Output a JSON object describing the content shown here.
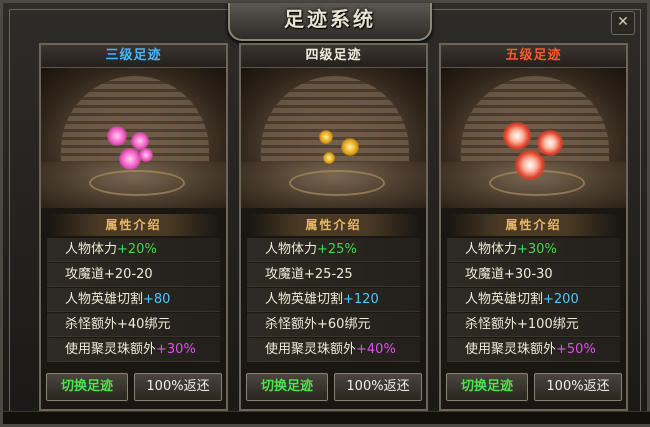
{
  "window": {
    "title": "足迹系统"
  },
  "panels": [
    {
      "tier": "三级足迹",
      "attr_header": "属性介绍",
      "attrs": [
        {
          "label": "人物体力",
          "value": "+20%"
        },
        {
          "label": "攻魔道",
          "value": "+20-20"
        },
        {
          "label": "人物英雄切割",
          "value": "+80"
        },
        {
          "label": "杀怪额外",
          "value": "+40绑元"
        },
        {
          "label": "使用聚灵珠额外",
          "value": "+30%"
        }
      ],
      "switch_label": "切换足迹",
      "refund_label": "100%返还"
    },
    {
      "tier": "四级足迹",
      "attr_header": "属性介绍",
      "attrs": [
        {
          "label": "人物体力",
          "value": "+25%"
        },
        {
          "label": "攻魔道",
          "value": "+25-25"
        },
        {
          "label": "人物英雄切割",
          "value": "+120"
        },
        {
          "label": "杀怪额外",
          "value": "+60绑元"
        },
        {
          "label": "使用聚灵珠额外",
          "value": "+40%"
        }
      ],
      "switch_label": "切换足迹",
      "refund_label": "100%返还"
    },
    {
      "tier": "五级足迹",
      "attr_header": "属性介绍",
      "attrs": [
        {
          "label": "人物体力",
          "value": "+30%"
        },
        {
          "label": "攻魔道",
          "value": "+30-30"
        },
        {
          "label": "人物英雄切割",
          "value": "+200"
        },
        {
          "label": "杀怪额外",
          "value": "+100绑元"
        },
        {
          "label": "使用聚灵珠额外",
          "value": "+50%"
        }
      ],
      "switch_label": "切换足迹",
      "refund_label": "100%返还"
    }
  ],
  "colors": {
    "tier_3": "#46b8ff",
    "tier_4": "#f0ece0",
    "tier_5": "#ff5a2a",
    "value_green": "#49d650",
    "value_cyan": "#4cc8ff",
    "value_magenta": "#e050f0"
  }
}
